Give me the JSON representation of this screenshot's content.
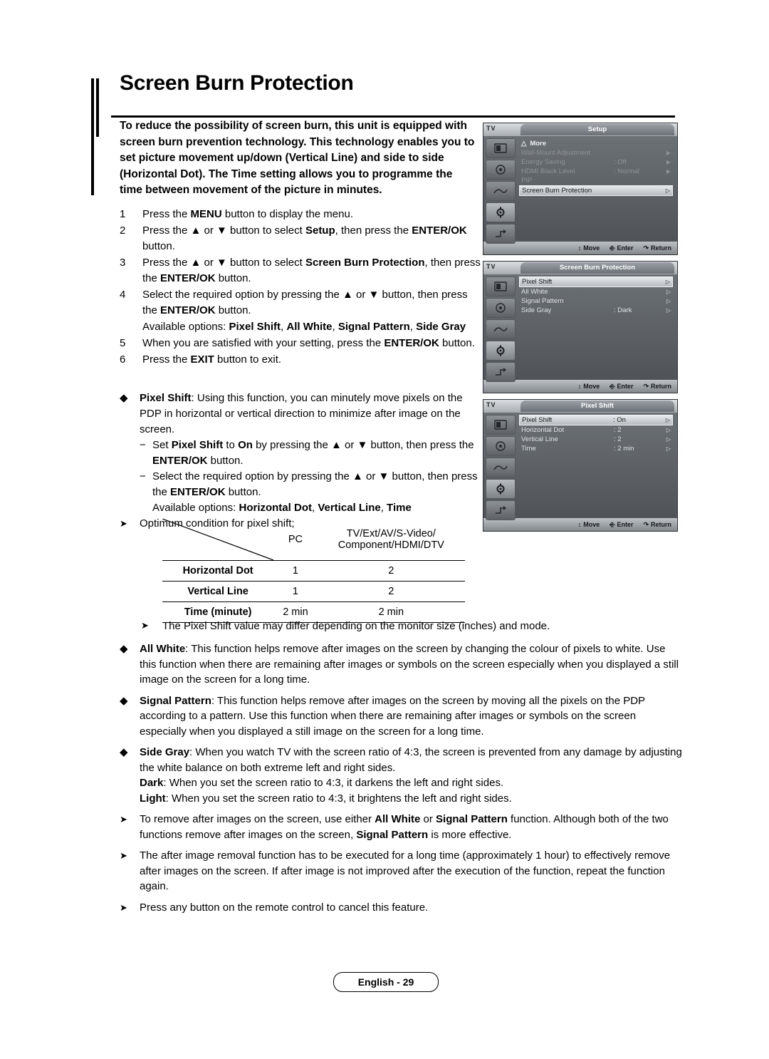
{
  "title": "Screen Burn Protection",
  "intro": "To reduce the possibility of screen burn, this unit is equipped with screen burn prevention technology. This technology enables you to set picture movement up/down (Vertical Line) and side to side (Horizontal Dot). The Time setting allows you to programme the time between movement of the picture in minutes.",
  "steps": [
    {
      "num": "1",
      "text": "Press the MENU button to display the menu."
    },
    {
      "num": "2",
      "text": "Press the ▲ or ▼ button to select Setup, then press the ENTER/OK button."
    },
    {
      "num": "3",
      "text": "Press the ▲ or ▼ button to select Screen Burn Protection, then press the ENTER/OK button."
    },
    {
      "num": "4",
      "text": "Select the required option by pressing the ▲ or ▼ button, then press the ENTER/OK button."
    },
    {
      "num": "",
      "text": "Available options: Pixel Shift, All White, Signal Pattern, Side Gray"
    },
    {
      "num": "5",
      "text": "When you are satisfied with your setting, press the ENTER/OK button."
    },
    {
      "num": "6",
      "text": "Press the EXIT button to exit."
    }
  ],
  "bullets": {
    "pixel_shift_lead": "Pixel Shift",
    "pixel_shift_body": ": Using this function, you can minutely move pixels on the PDP in horizontal or vertical direction to minimize after image on the screen.",
    "dash1": "Set Pixel Shift to On by pressing the ▲ or ▼ button, then press the ENTER/OK button.",
    "dash2": "Select the required option by pressing the ▲ or ▼ button, then press the ENTER/OK button.",
    "available_options": "Available options: Horizontal Dot, Vertical Line, Time",
    "optimum": "Optimum condition for pixel shift;"
  },
  "table": {
    "col_headers": [
      "",
      "PC",
      "TV/Ext/AV/S-Video/ Component/HDMI/DTV"
    ],
    "col_header_2_line1": "TV/Ext/AV/S-Video/",
    "col_header_2_line2": "Component/HDMI/DTV",
    "rows": [
      {
        "label": "Horizontal Dot",
        "pc": "1",
        "other": "2"
      },
      {
        "label": "Vertical Line",
        "pc": "1",
        "other": "2"
      },
      {
        "label": "Time (minute)",
        "pc": "2 min",
        "other": "2 min"
      }
    ],
    "note": "The Pixel Shift value may differ depending on the monitor size (inches) and mode."
  },
  "lower_bullets": [
    {
      "lead": "All White",
      "body": ": This function helps remove after images on the screen by changing the colour of pixels to white. Use this function when there are remaining after images or symbols on the screen especially when you displayed a still image on the screen for a long time."
    },
    {
      "lead": "Signal Pattern",
      "body": ": This function helps remove after images on the screen by moving all the pixels on the PDP according to a pattern. Use this function when there are remaining after images or symbols on the screen especially when you displayed a still image on the screen for a long time."
    },
    {
      "lead": "Side Gray",
      "body": ": When you watch TV with the screen ratio of 4:3, the screen is prevented from any damage by adjusting the white balance on both extreme left and right sides."
    },
    {
      "lead": "Dark",
      "body": ": When you set the screen ratio to 4:3, it darkens the left and right sides."
    },
    {
      "lead": "Light",
      "body": ": When you set the screen ratio to 4:3, it brightens the left and right sides."
    }
  ],
  "arrow_notes": [
    "To remove after images on the screen, use either All White or Signal Pattern function. Although both of the two functions remove after images on the screen, Signal Pattern is more effective.",
    "The after image removal function has to be executed for a long time (approximately 1 hour) to effectively remove after images on the screen. If after image is not improved after the execution of the function, repeat the function again.",
    "Press any button on the remote control to cancel this feature."
  ],
  "osd": {
    "tv_label": "TV",
    "footer": {
      "move": "Move",
      "enter": "Enter",
      "return": "Return"
    },
    "panel1": {
      "title": "Setup",
      "more": "More",
      "rows": [
        {
          "label": "Wall-Mount Adjustment",
          "value": "",
          "arrow": "▶",
          "state": "dim"
        },
        {
          "label": "Energy Saving",
          "value": ": Off",
          "arrow": "▶",
          "state": "dim"
        },
        {
          "label": "HDMI Black Level",
          "value": ": Normal",
          "arrow": "▶",
          "state": "dim"
        },
        {
          "label": "PIP",
          "value": "",
          "arrow": "",
          "state": "dim"
        },
        {
          "label": "Screen Burn Protection",
          "value": "",
          "arrow": "▷",
          "state": "hl"
        }
      ]
    },
    "panel2": {
      "title": "Screen Burn Protection",
      "rows": [
        {
          "label": "Pixel Shift",
          "value": "",
          "arrow": "▷",
          "state": "hl"
        },
        {
          "label": "All White",
          "value": "",
          "arrow": "▷",
          "state": "normal"
        },
        {
          "label": "Signal Pattern",
          "value": "",
          "arrow": "▷",
          "state": "normal"
        },
        {
          "label": "Side Gray",
          "value": ": Dark",
          "arrow": "▷",
          "state": "normal"
        }
      ]
    },
    "panel3": {
      "title": "Pixel Shift",
      "rows": [
        {
          "label": "Pixel Shift",
          "value": ": On",
          "arrow": "▷",
          "state": "hl"
        },
        {
          "label": "Horizontal Dot",
          "value": ": 2",
          "arrow": "▷",
          "state": "normal"
        },
        {
          "label": "Vertical Line",
          "value": ": 2",
          "arrow": "▷",
          "state": "normal"
        },
        {
          "label": "Time",
          "value": ": 2 min",
          "arrow": "▷",
          "state": "normal"
        }
      ]
    }
  },
  "footer": "English - 29"
}
